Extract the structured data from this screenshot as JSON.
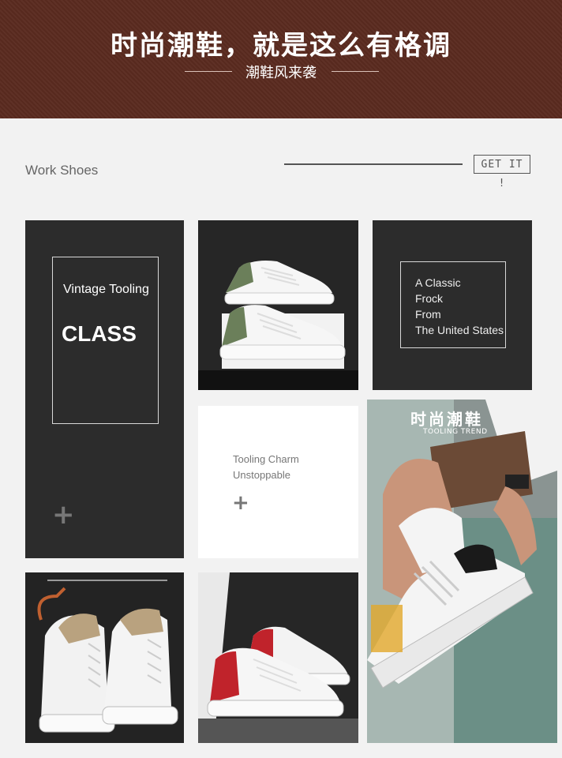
{
  "banner": {
    "title": "时尚潮鞋，就是这么有格调",
    "subtitle": "潮鞋风来袭",
    "bg_color": "#5a2a1f"
  },
  "section": {
    "label": "Work Shoes",
    "cta_label": "GET IT !"
  },
  "tiles": {
    "vintage": {
      "label": "Vintage Tooling",
      "headline": "CLASS",
      "plus": "+"
    },
    "classic": {
      "line1": "A Classic",
      "line2": "Frock",
      "line3": "From",
      "line4": "The United States"
    },
    "charm": {
      "line1": "Tooling Charm",
      "line2": "Unstoppable",
      "plus": "+"
    },
    "lifestyle": {
      "title": "时尚潮鞋",
      "subtitle": "TOOLING TREND"
    }
  },
  "images": {
    "green_sneakers": {
      "accent": "#6b7f5a"
    },
    "tan_sneakers": {
      "accent": "#b9a27f"
    },
    "red_sneakers": {
      "accent": "#c0232b"
    },
    "black_sneaker": {
      "accent": "#1a1a1a"
    }
  }
}
